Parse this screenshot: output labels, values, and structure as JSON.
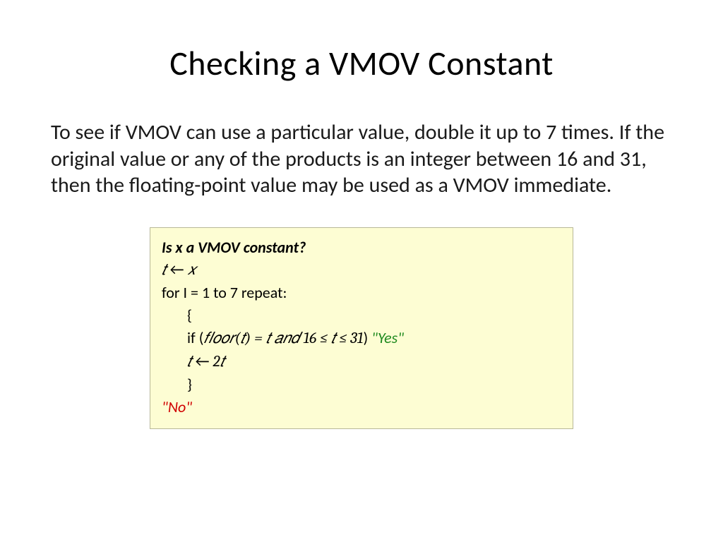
{
  "title": "Checking a VMOV Constant",
  "body": "To see if VMOV can use a particular value, double it up to 7 times. If the original value or any of the products is an integer between 16 and 31, then the floating-point value may be used as a VMOV immediate.",
  "algo": {
    "heading": "Is x a VMOV constant?",
    "line1_lhs": "𝑡",
    "line1_arrow": " ← ",
    "line1_rhs": "𝑥",
    "line2": "for I = 1 to 7 repeat:",
    "brace_open": "{",
    "cond_prefix": "if (",
    "cond_expr": "𝑓𝑙𝑜𝑜𝑟(𝑡) = 𝑡 𝑎𝑛𝑑 16 ≤ 𝑡 ≤ 31",
    "cond_suffix": ") ",
    "yes": "\"Yes\"",
    "update_lhs": "𝑡",
    "update_arrow": " ← ",
    "update_rhs": "2𝑡",
    "brace_close": "}",
    "no": "\"No\""
  }
}
